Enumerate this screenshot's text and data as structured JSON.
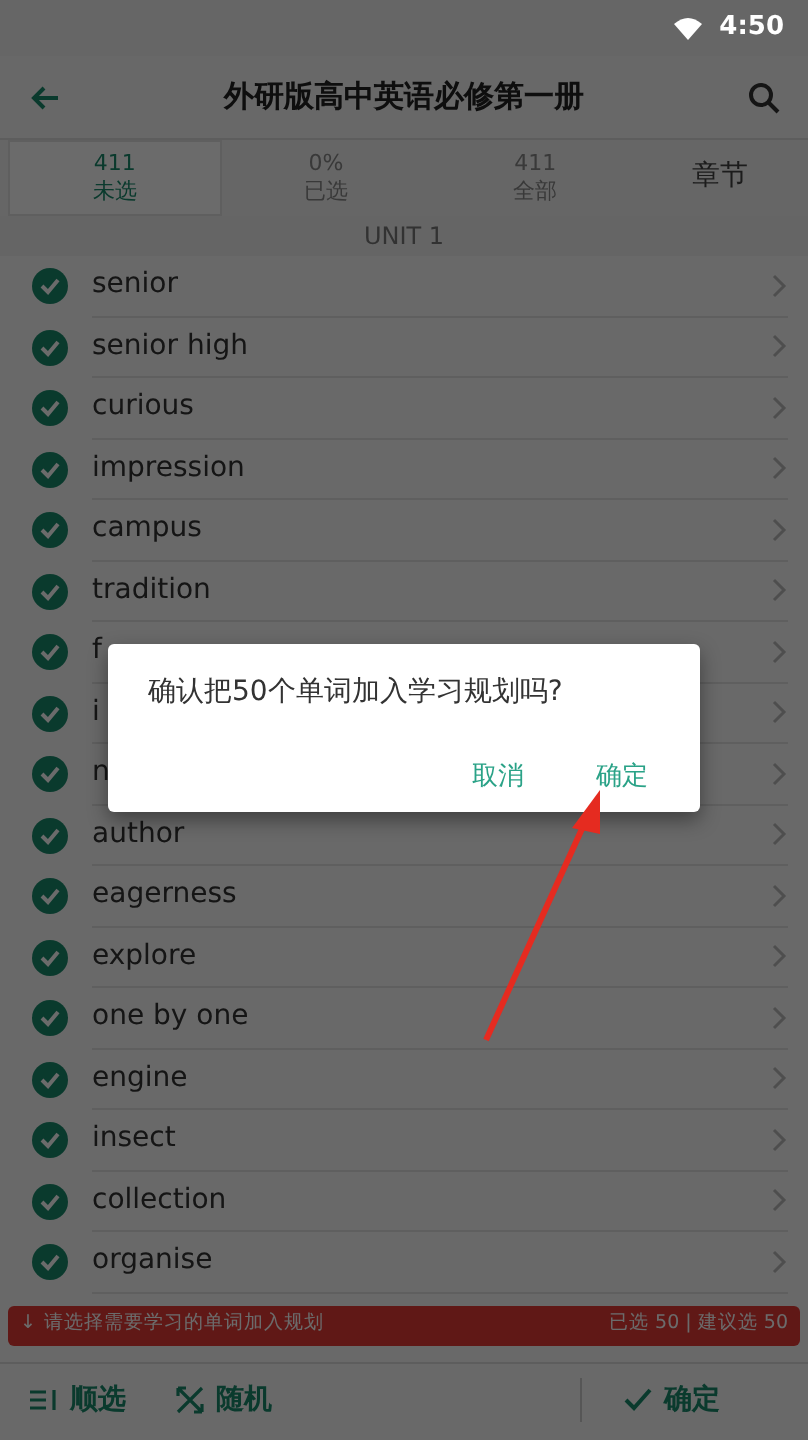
{
  "status_bar": {
    "time": "4:50"
  },
  "app_bar": {
    "title": "外研版高中英语必修第一册"
  },
  "tabs": [
    {
      "value": "411",
      "label": "未选",
      "selected": true
    },
    {
      "value": "0%",
      "label": "已选",
      "selected": false
    },
    {
      "value": "411",
      "label": "全部",
      "selected": false
    },
    {
      "label": "章节",
      "selected": false
    }
  ],
  "section": "UNIT 1",
  "words": [
    {
      "word": "senior",
      "checked": true
    },
    {
      "word": "senior high",
      "checked": true
    },
    {
      "word": "curious",
      "checked": true
    },
    {
      "word": "impression",
      "checked": true
    },
    {
      "word": "campus",
      "checked": true
    },
    {
      "word": "tradition",
      "checked": true
    },
    {
      "word": "f",
      "checked": true
    },
    {
      "word": "i",
      "checked": true
    },
    {
      "word": "n",
      "checked": true
    },
    {
      "word": "author",
      "checked": true
    },
    {
      "word": "eagerness",
      "checked": true
    },
    {
      "word": "explore",
      "checked": true
    },
    {
      "word": "one by one",
      "checked": true
    },
    {
      "word": "engine",
      "checked": true
    },
    {
      "word": "insect",
      "checked": true
    },
    {
      "word": "collection",
      "checked": true
    },
    {
      "word": "organise",
      "checked": true
    }
  ],
  "banner": {
    "arrow": "↓",
    "hint": "请选择需要学习的单词加入规划",
    "counts": "已选 50 | 建议选 50"
  },
  "bottom_bar": [
    {
      "kind": "order",
      "label": "顺选"
    },
    {
      "kind": "random",
      "label": "随机"
    },
    {
      "kind": "confirm",
      "label": "确定"
    }
  ],
  "dialog": {
    "message": "确认把50个单词加入学习规划吗?",
    "buttons": [
      "取消",
      "确定"
    ]
  }
}
